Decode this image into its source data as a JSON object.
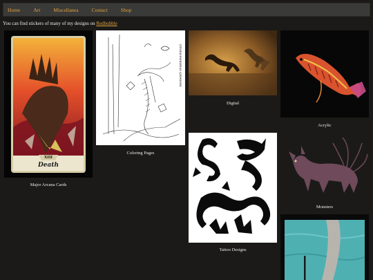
{
  "nav": {
    "items": [
      "Home",
      "Art",
      "Miscellanea",
      "Contact",
      "Shop"
    ]
  },
  "intro": {
    "text": "You can find stickers of many of my designs on",
    "link": "Redbubble"
  },
  "gallery": {
    "tiles": [
      {
        "caption": "Major Arcana Cards",
        "card_number": "XIII",
        "card_title": "Death"
      },
      {
        "caption": "Coloring Pages",
        "watermark": "Dromiceiomimus @nemoni"
      },
      {
        "caption": "Digital"
      },
      {
        "caption": "Acrylic"
      },
      {
        "caption": "Tattoo Designs"
      },
      {
        "caption": "Monsters"
      }
    ]
  },
  "colors": {
    "background": "#1b1a19",
    "nav_bg": "#3a3a39",
    "link": "#e2a23a",
    "text": "#efece4"
  }
}
